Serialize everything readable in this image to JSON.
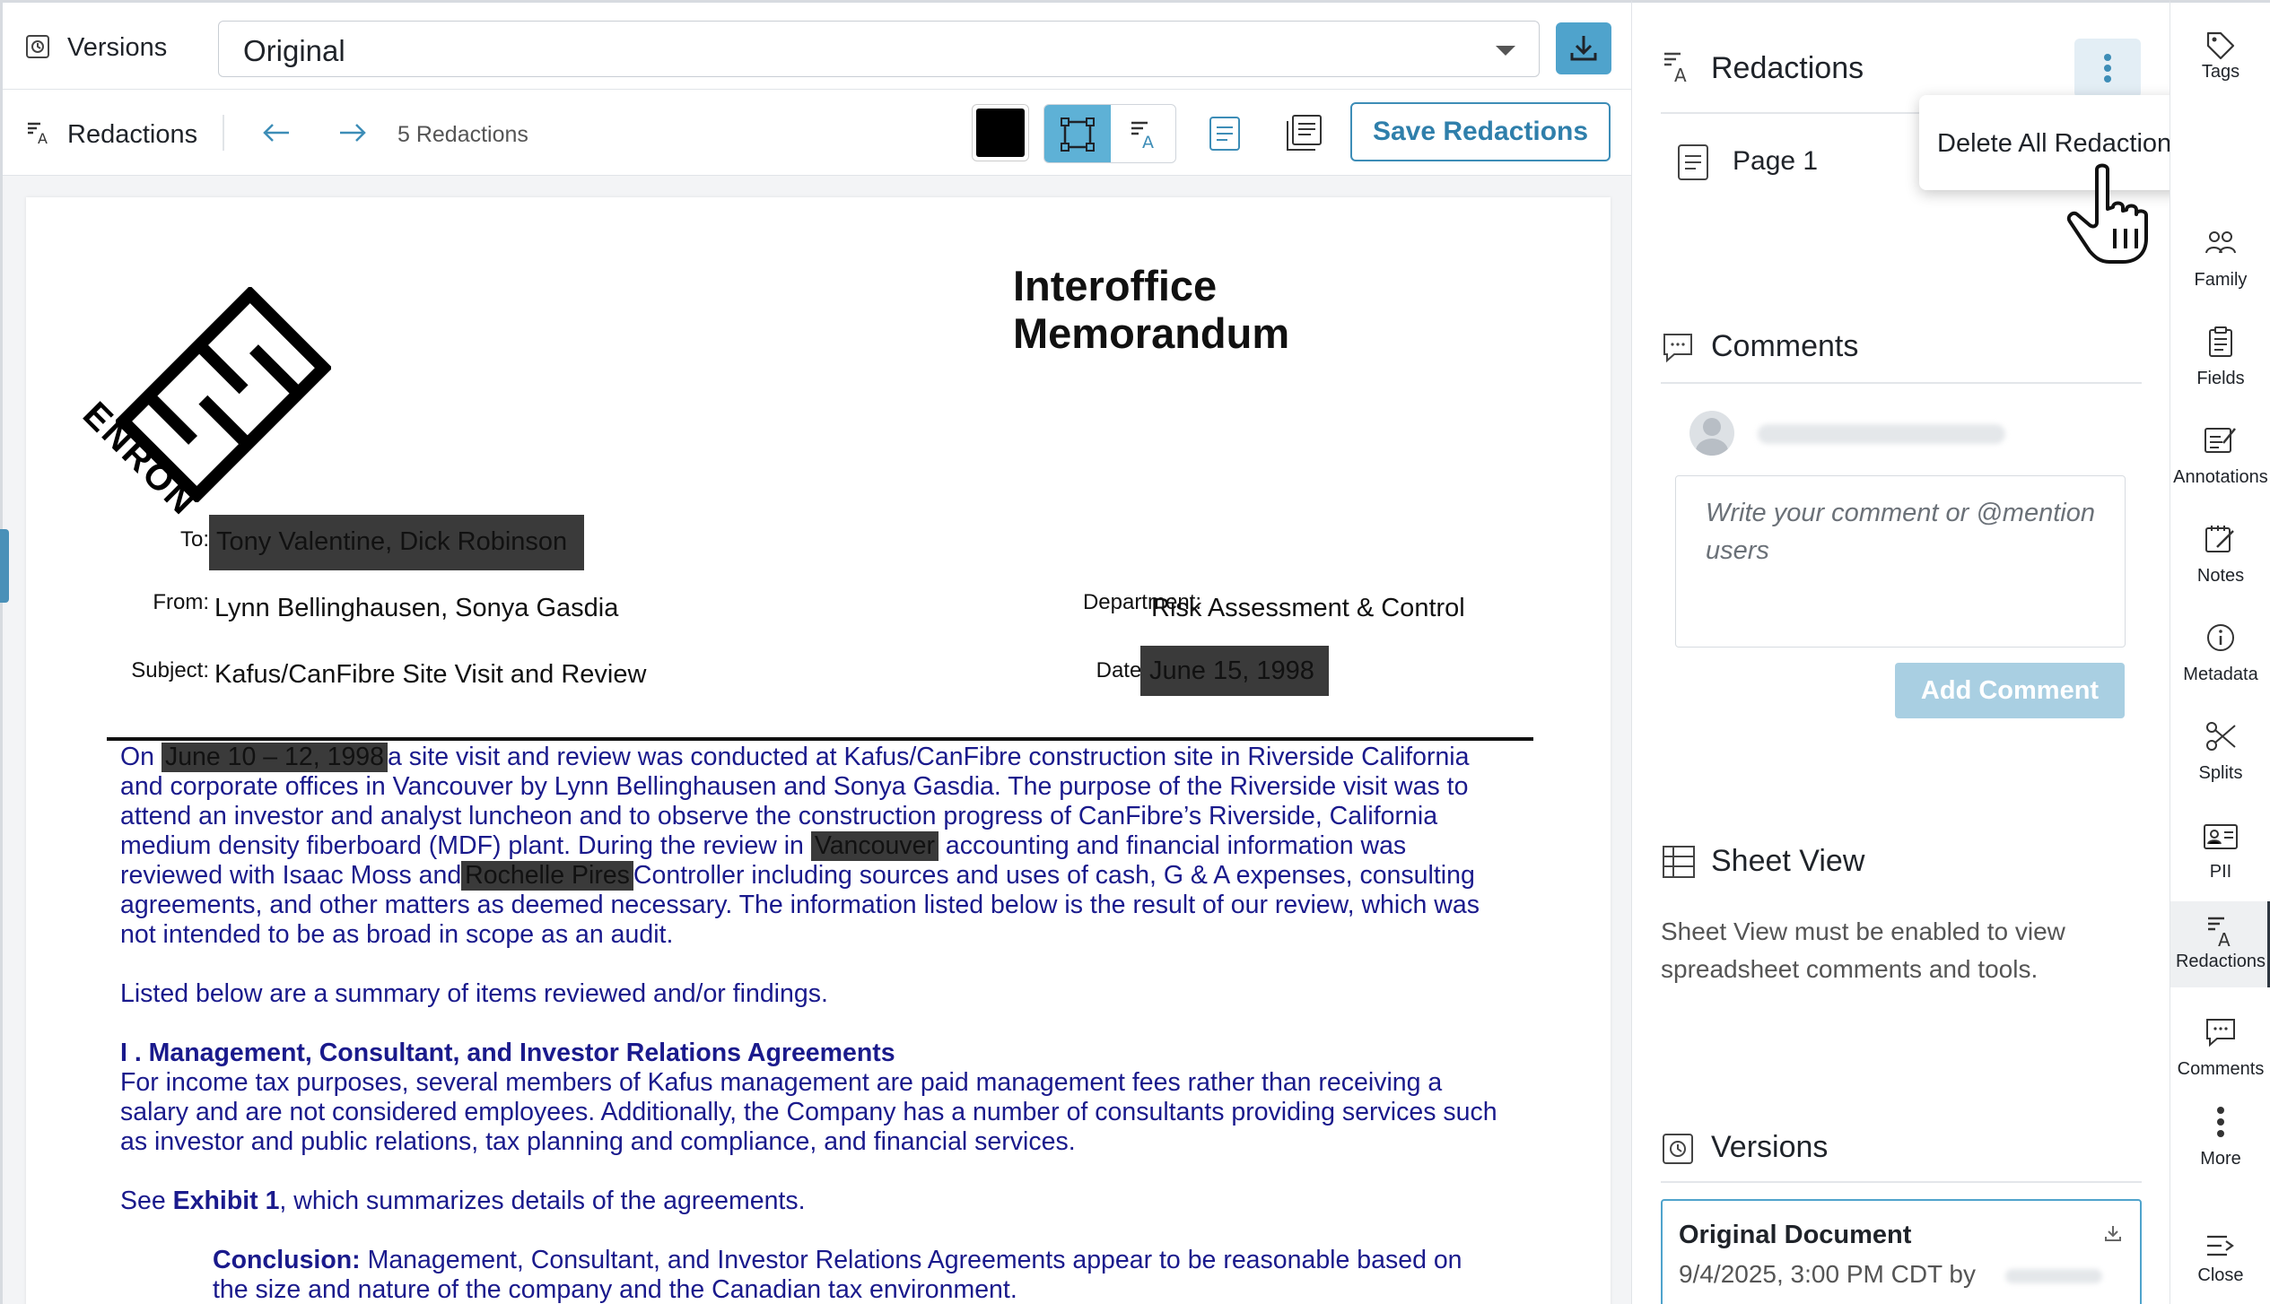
{
  "toolbar": {
    "versions_label": "Versions",
    "version_select": "Original",
    "redactions_label": "Redactions",
    "redaction_count": "5 Redactions",
    "save_label": "Save Redactions"
  },
  "document": {
    "title_line1": "Interoffice",
    "title_line2": "Memorandum",
    "logo_text": "ENRON",
    "to_key": "To:",
    "to_val": "Tony Valentine, Dick Robinson",
    "from_key": "From:",
    "from_val": "Lynn Bellinghausen, Sonya Gasdia",
    "dept_key": "Department:",
    "dept_val": "Risk Assessment & Control",
    "subject_key": "Subject:",
    "subject_val": "Kafus/CanFibre Site Visit and Review",
    "date_key": "Date:",
    "date_val": "June 15, 1998",
    "p1_l1a": "On",
    "p1_l1_red": "June 10 – 12, 1998",
    "p1_l1b": "a site visit and review was conducted at Kafus/CanFibre construction site in Riverside California",
    "p1_l2": "and corporate offices in Vancouver by Lynn Bellinghausen and Sonya Gasdia.  The purpose of the Riverside visit was to",
    "p1_l3": "attend an investor and analyst luncheon and to observe the construction progress of CanFibre’s Riverside, California",
    "p1_l4a": "medium density fiberboard (MDF) plant. During the review in",
    "p1_l4_red": "Vancouver",
    "p1_l4b": " accounting and financial information was",
    "p1_l5a": "reviewed with Isaac Moss and",
    "p1_l5_red": "Rochelle Pires",
    "p1_l5b": "Controller including sources and uses of cash, G & A expenses, consulting",
    "p1_l6": "agreements, and other matters as deemed necessary. The information listed below is the result of our review, which was",
    "p1_l7": "not intended to be as broad in scope as an audit.",
    "p2": "Listed below are a summary of items reviewed and/or findings.",
    "h1": "I . Management, Consultant, and Investor Relations Agreements",
    "p3_l1": " For income tax purposes, several members of Kafus management are paid management fees rather than receiving a",
    "p3_l2": "salary and are not considered employees. Additionally, the Company has a number of consultants providing services such",
    "p3_l3": "as investor and public relations, tax planning and compliance, and financial services.",
    "p4a": "See ",
    "p4b": "Exhibit 1",
    "p4c": ", which summarizes details of the agreements.",
    "concl_label": "Conclusion:",
    "concl_l1": " Management, Consultant, and Investor Relations Agreements appear to be reasonable based on",
    "concl_l2": "the size and nature of the company and the Canadian tax environment."
  },
  "panel": {
    "redactions_title": "Redactions",
    "page_label": "Page 1",
    "menu_item": "Delete All Redactions",
    "comments_title": "Comments",
    "comment_placeholder": "Write your comment or @mention users",
    "add_comment": "Add Comment",
    "sheet_title": "Sheet View",
    "sheet_text_l1": "Sheet View must be enabled to view",
    "sheet_text_l2": "spreadsheet comments and tools.",
    "versions_title": "Versions",
    "version_name": "Original Document",
    "version_meta": "9/4/2025, 3:00 PM CDT by"
  },
  "rail": {
    "tags": "Tags",
    "family": "Family",
    "fields": "Fields",
    "annotations": "Annotations",
    "notes": "Notes",
    "metadata": "Metadata",
    "splits": "Splits",
    "pii": "PII",
    "redactions": "Redactions",
    "comments": "Comments",
    "more": "More",
    "close": "Close"
  },
  "colors": {
    "accent": "#4fa3cc",
    "doc_text": "#1a1a8c",
    "redaction": "#3a3a3a"
  }
}
